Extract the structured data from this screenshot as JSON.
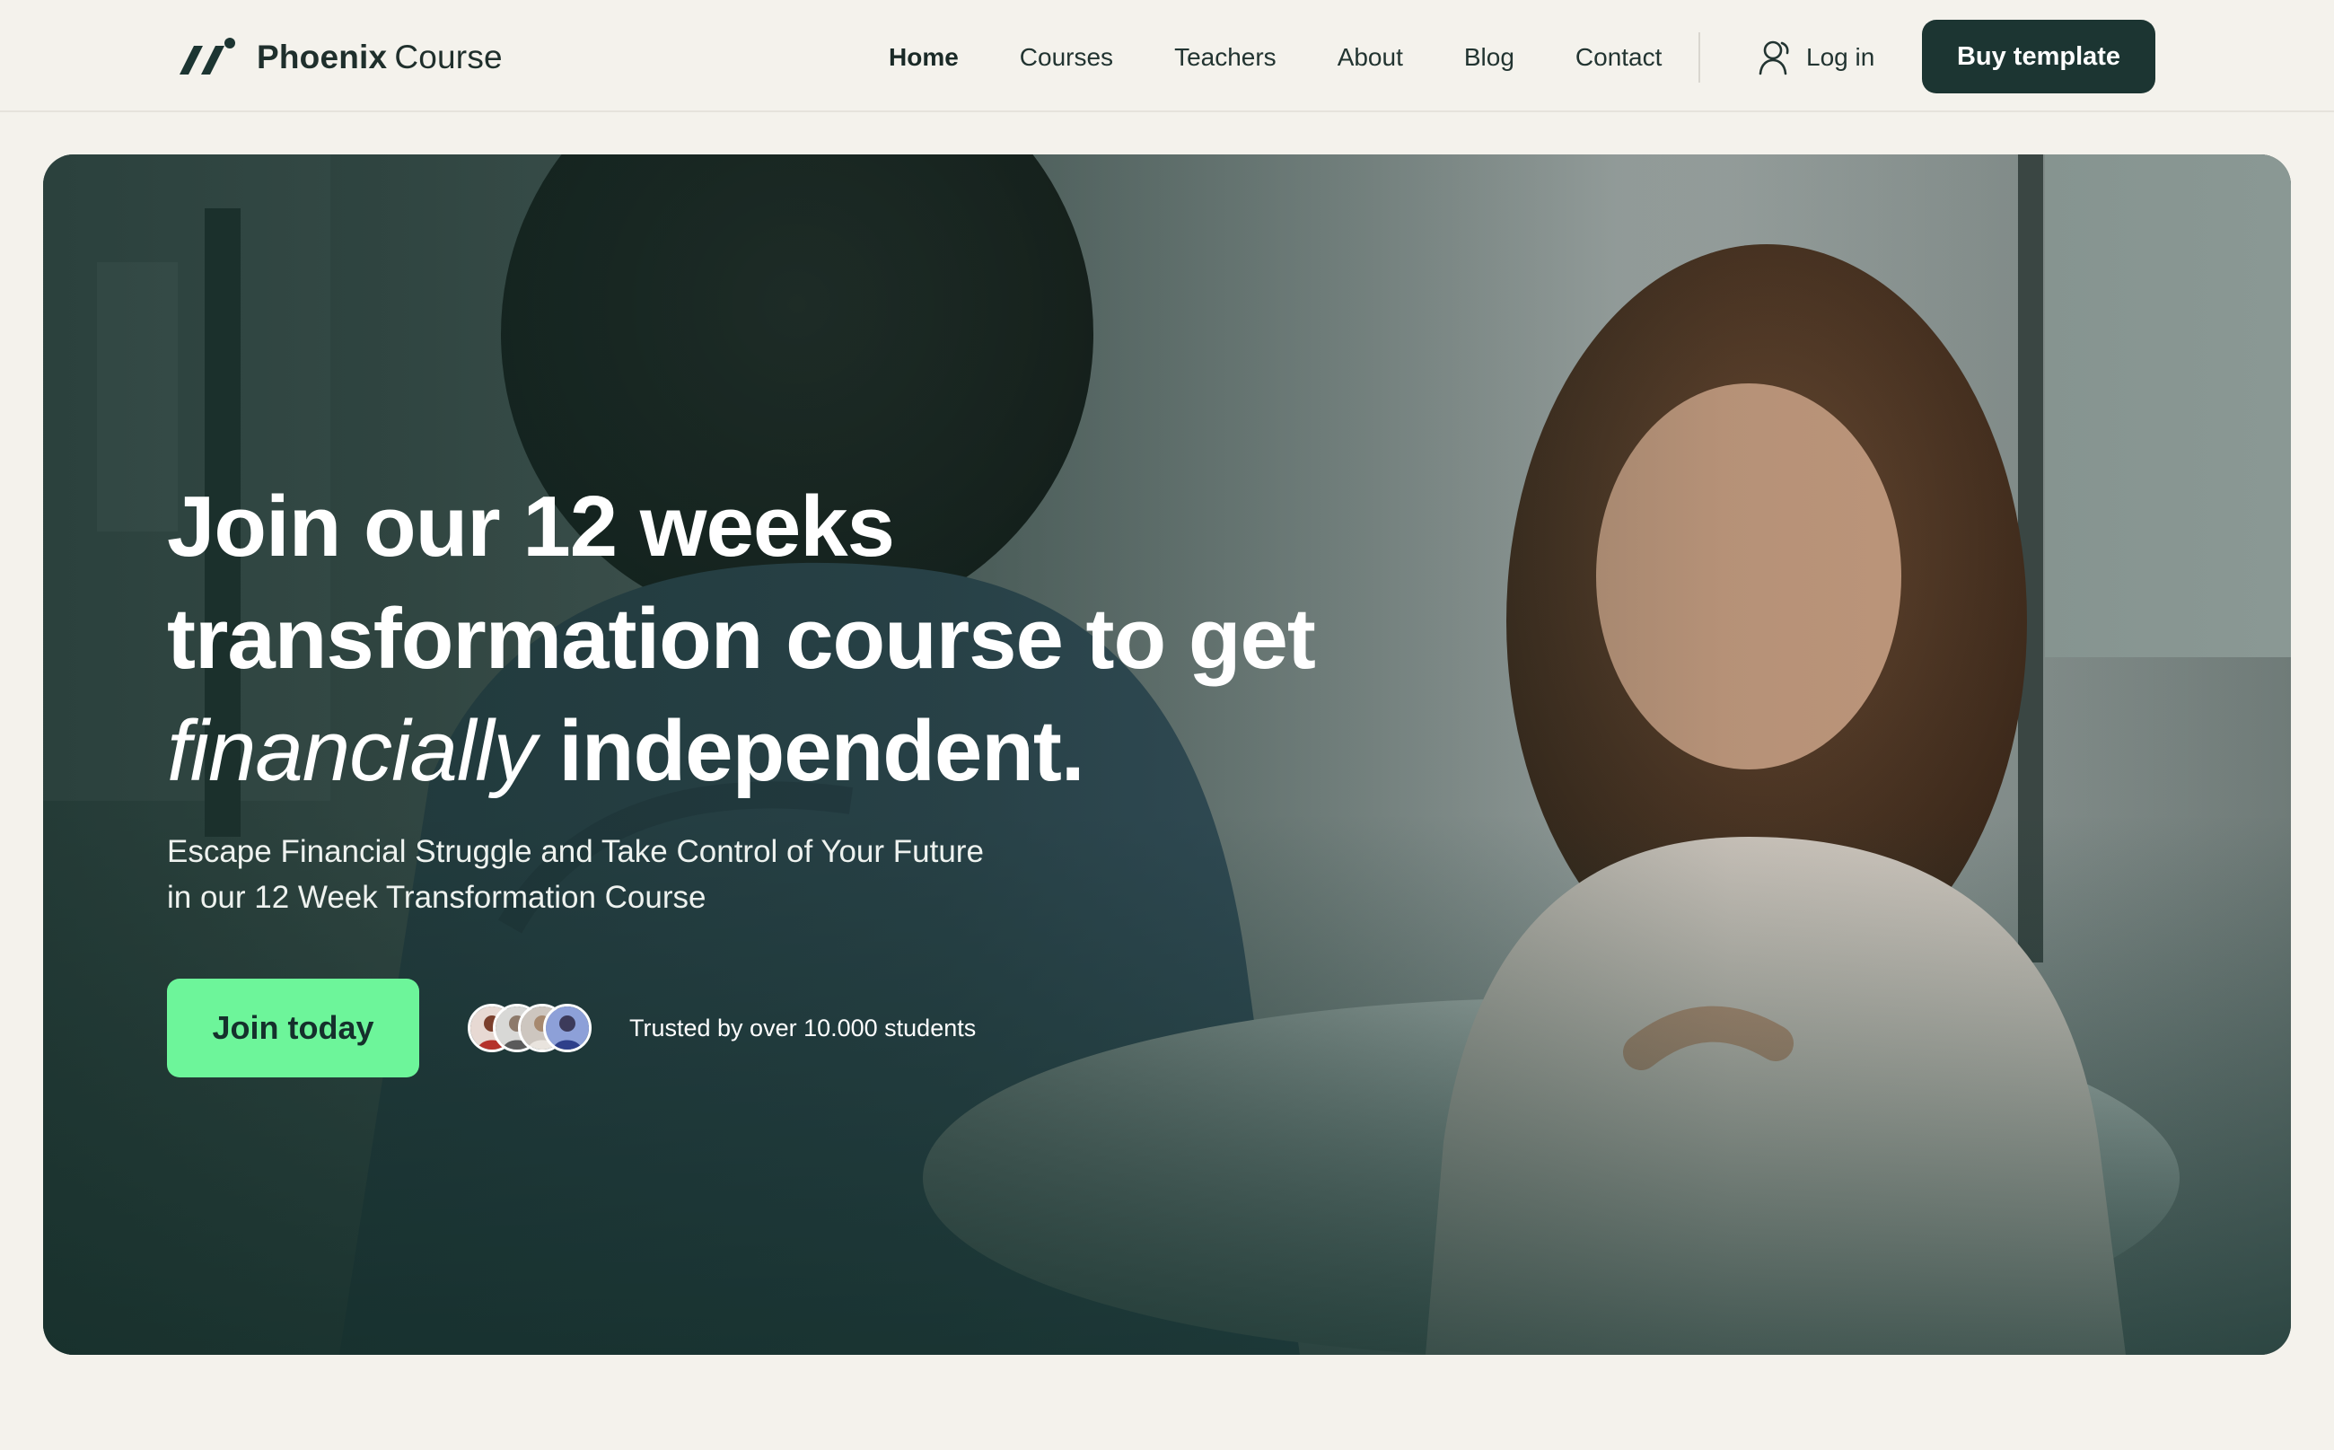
{
  "brand": {
    "name_strong": "Phoenix",
    "name_light": "Course",
    "logo_icon": "phoenix-slashes-logo"
  },
  "nav": {
    "links": [
      "Home",
      "Courses",
      "Teachers",
      "About",
      "Blog",
      "Contact"
    ],
    "active": "Home",
    "login_label": "Log in",
    "login_icon": "user-icon",
    "buy_label": "Buy template"
  },
  "hero": {
    "title_line1": "Join our 12 weeks",
    "title_line2": "transformation course to get",
    "title_italic": "financially",
    "title_end": "independent.",
    "subtitle_line1": "Escape Financial Struggle and Take Control of Your Future",
    "subtitle_line2": "in our 12 Week Transformation Course",
    "cta_label": "Join today",
    "trusted_text": "Trusted by over 10.000 students"
  },
  "colors": {
    "background": "#f4f2ec",
    "brand_dark": "#1c3532",
    "accent_green": "#6df59a",
    "text_dark": "#223431"
  }
}
